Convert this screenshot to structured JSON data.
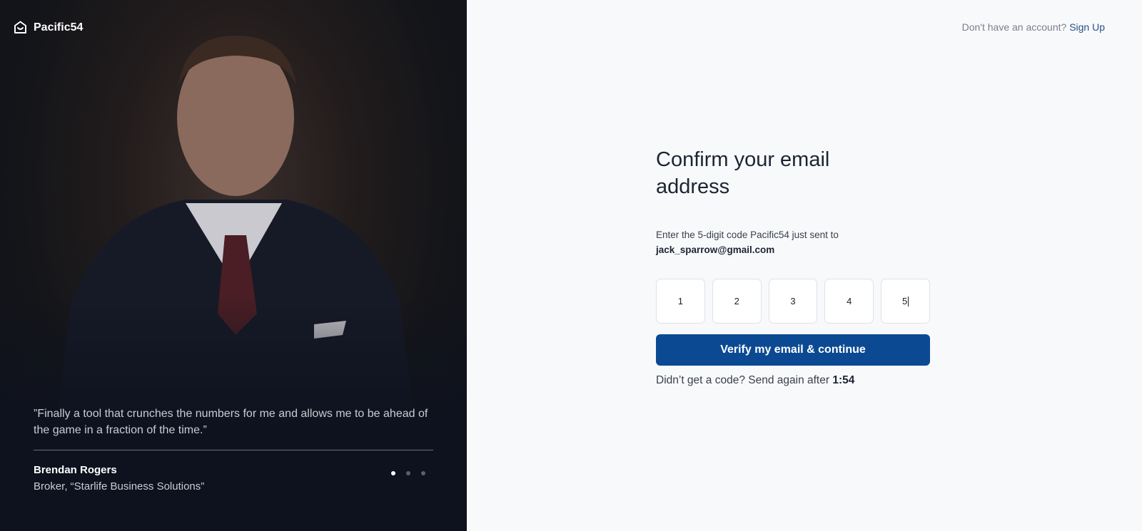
{
  "brand": {
    "name": "Pacific54"
  },
  "testimonial": {
    "quote": "”Finally a tool that crunches the numbers for me and allows me to be ahead of the game in a fraction of the time.”",
    "author": "Brendan Rogers",
    "role": "Broker, “Starlife Business Solutions”",
    "slide_count": 3,
    "active_slide": 1
  },
  "header": {
    "prompt": "Don't have an account?",
    "signup_label": "Sign Up"
  },
  "form": {
    "title": "Confirm your email address",
    "description": "Enter the 5-digit code Pacific54 just sent to",
    "email": "jack_sparrow@gmail.com",
    "code_digits": [
      "1",
      "2",
      "3",
      "4",
      "5"
    ],
    "submit_label": "Verify my email & continue",
    "resend_text": "Didn’t get a code? Send again after",
    "timer": "1:54"
  }
}
